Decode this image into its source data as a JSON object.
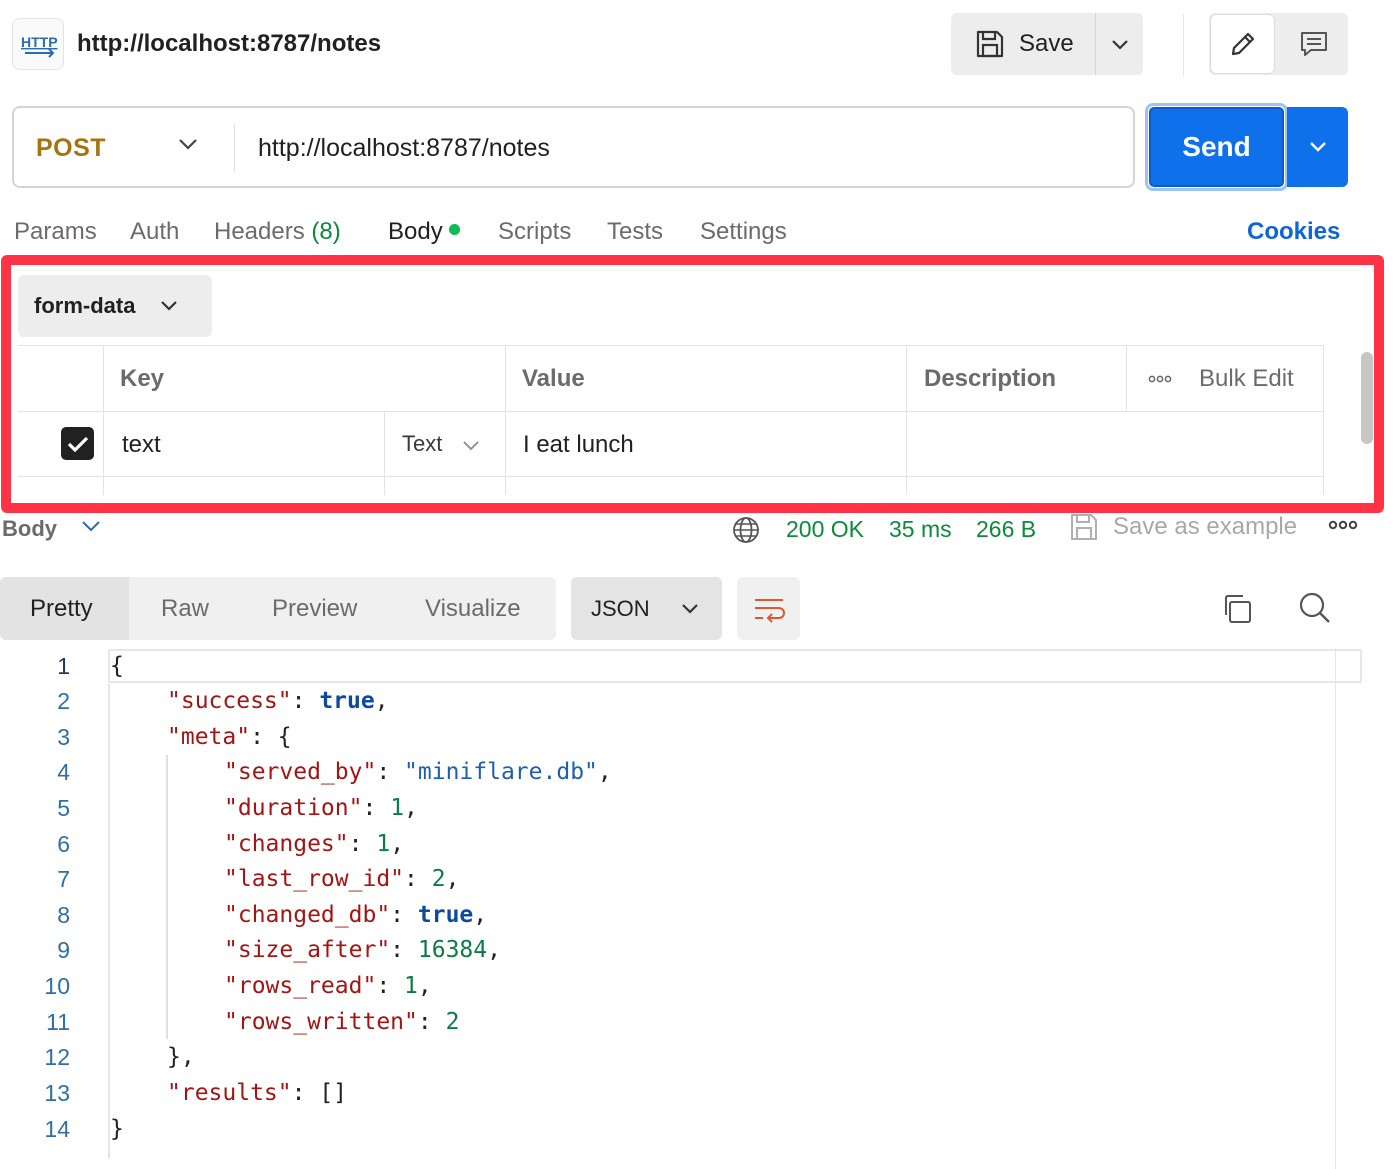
{
  "header": {
    "title": "http://localhost:8787/notes",
    "save_label": "Save"
  },
  "request": {
    "method": "POST",
    "url": "http://localhost:8787/notes",
    "send_label": "Send"
  },
  "tabs": {
    "params": "Params",
    "auth": "Auth",
    "headers": "Headers",
    "headers_count": "(8)",
    "body": "Body",
    "scripts": "Scripts",
    "tests": "Tests",
    "settings": "Settings",
    "cookies": "Cookies"
  },
  "body_editor": {
    "type": "form-data",
    "columns": {
      "key": "Key",
      "value": "Value",
      "description": "Description",
      "bulk_edit": "Bulk Edit"
    },
    "rows": [
      {
        "checked": true,
        "key": "text",
        "type": "Text",
        "value": "I eat lunch",
        "description": ""
      }
    ]
  },
  "response": {
    "label": "Body",
    "status": "200 OK",
    "time": "35 ms",
    "size": "266 B",
    "save_example": "Save as example",
    "view_tabs": [
      "Pretty",
      "Raw",
      "Preview",
      "Visualize"
    ],
    "format": "JSON"
  },
  "code_lines": [
    "1",
    "2",
    "3",
    "4",
    "5",
    "6",
    "7",
    "8",
    "9",
    "10",
    "11",
    "12",
    "13",
    "14"
  ],
  "json_text": {
    "l1": "{",
    "success_key": "\"success\"",
    "success_val": "true",
    "meta_key": "\"meta\"",
    "served_by_key": "\"served_by\"",
    "served_by_val": "\"miniflare.db\"",
    "duration_key": "\"duration\"",
    "duration_val": "1",
    "changes_key": "\"changes\"",
    "changes_val": "1",
    "last_row_id_key": "\"last_row_id\"",
    "last_row_id_val": "2",
    "changed_db_key": "\"changed_db\"",
    "changed_db_val": "true",
    "size_after_key": "\"size_after\"",
    "size_after_val": "16384",
    "rows_read_key": "\"rows_read\"",
    "rows_read_val": "1",
    "rows_written_key": "\"rows_written\"",
    "rows_written_val": "2",
    "results_key": "\"results\"",
    "results_val": "[]"
  }
}
